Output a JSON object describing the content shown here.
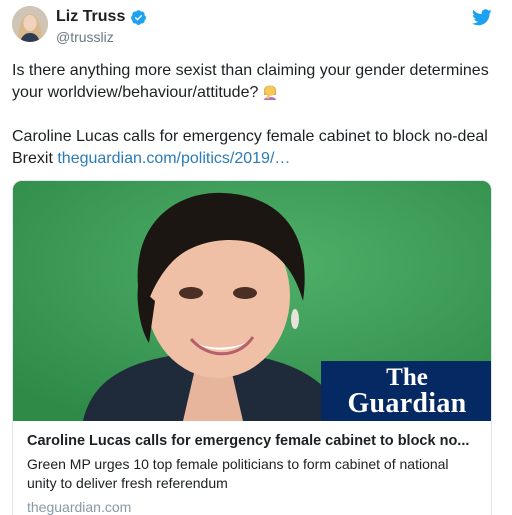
{
  "author": {
    "display_name": "Liz Truss",
    "handle": "@trussliz",
    "verified_icon": "verified-badge-icon",
    "avatar": "profile-photo"
  },
  "platform_icon": "twitter-bird-icon",
  "tweet": {
    "paragraph1": "Is there anything more sexist than claiming your gender determines your worldview/behaviour/attitude?",
    "emoji": "woman-facepalming-emoji",
    "paragraph2_text": "Caroline Lucas calls for emergency female cabinet to block no-deal Brexit",
    "paragraph2_link": "theguardian.com/politics/2019/…"
  },
  "card": {
    "image": "woman-portrait-green-background",
    "logo_line1": "The",
    "logo_line2": "Guardian",
    "title": "Caroline Lucas calls for emergency female cabinet to block no...",
    "description": "Green MP urges 10 top female politicians to form cabinet of national unity to deliver fresh referendum",
    "domain": "theguardian.com"
  },
  "colors": {
    "link": "#2b7bb9",
    "twitter_blue": "#1da1f2",
    "guardian_navy": "#052962",
    "photo_green": "#3a9c55",
    "muted_text": "#697882"
  }
}
